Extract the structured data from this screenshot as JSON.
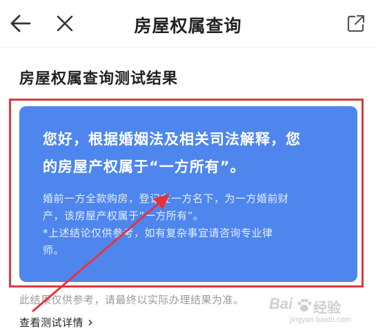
{
  "nav": {
    "title": "房屋权属查询",
    "back_icon": "back-arrow-icon",
    "close_icon": "close-icon",
    "share_icon": "share-external-icon"
  },
  "section": {
    "title": "房屋权属查询测试结果"
  },
  "card": {
    "headline_line1": "您好，根据婚姻法及相关司法解释，您",
    "headline_line2": "的房屋产权属于“一方所有”。",
    "body_line1": "婚前一方全款购房，登记在一方名下，为一方婚前财",
    "body_line2": "产，该房屋产权属于“一方所有”。",
    "note_line1": "*上述结论仅供参考，如有复杂事宜请咨询专业律",
    "note_line2": "师。",
    "background_color": "#4e86ee"
  },
  "disclaimer": "此结果仅供参考，请最终以实际办理结果为准。",
  "details_link": {
    "label": "查看测试详情",
    "chevron": "›"
  },
  "annotation": {
    "frame_color": "#d9393f",
    "arrow_color": "#e8323a"
  },
  "watermark": {
    "brand_main": "Bai",
    "brand_cn": "经验",
    "url": "jingyan.baidu.com"
  }
}
